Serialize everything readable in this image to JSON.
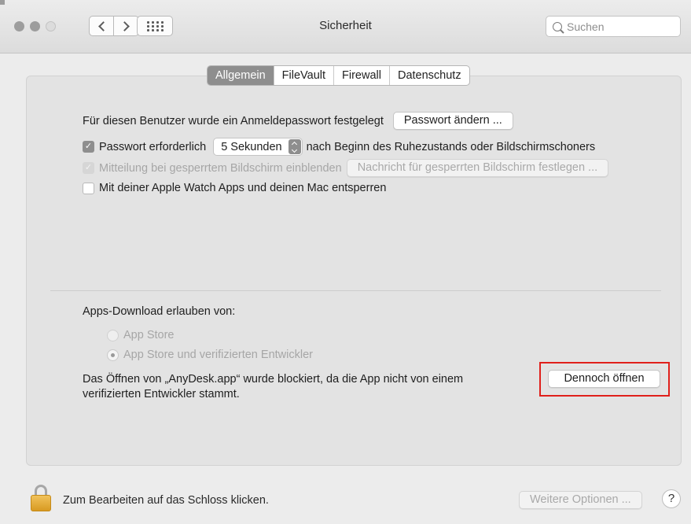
{
  "window": {
    "title": "Sicherheit",
    "search_placeholder": "Suchen"
  },
  "tabs": [
    {
      "label": "Allgemein",
      "active": true
    },
    {
      "label": "FileVault",
      "active": false
    },
    {
      "label": "Firewall",
      "active": false
    },
    {
      "label": "Datenschutz",
      "active": false
    }
  ],
  "general": {
    "password_set_text": "Für diesen Benutzer wurde ein Anmeldepasswort festgelegt",
    "change_password_button": "Passwort ändern ...",
    "require_password_label": "Passwort erforderlich",
    "require_password_checked": true,
    "delay_value": "5 Sekunden",
    "after_sleep_text": "nach Beginn des Ruhezustands oder Bildschirmschoners",
    "lock_message_label": "Mitteilung bei gesperrtem Bildschirm einblenden",
    "lock_message_checked": true,
    "lock_message_button": "Nachricht für gesperrten Bildschirm festlegen ...",
    "apple_watch_label": "Mit deiner Apple Watch Apps und deinen Mac entsperren",
    "apple_watch_checked": false
  },
  "downloads": {
    "heading": "Apps-Download erlauben von:",
    "options": [
      {
        "label": "App Store",
        "selected": false
      },
      {
        "label": "App Store und verifizierten Entwickler",
        "selected": true
      }
    ],
    "blocked_line1": "Das Öffnen von „AnyDesk.app“ wurde blockiert, da die App nicht von einem",
    "blocked_line2": "verifizierten Entwickler stammt.",
    "open_anyway_button": "Dennoch öffnen"
  },
  "footer": {
    "lock_hint": "Zum Bearbeiten auf das Schloss klicken.",
    "more_options_button": "Weitere Optionen ...",
    "help_label": "?"
  },
  "colors": {
    "highlight_border": "#e0201b",
    "lock_body": "#e3ab34"
  }
}
